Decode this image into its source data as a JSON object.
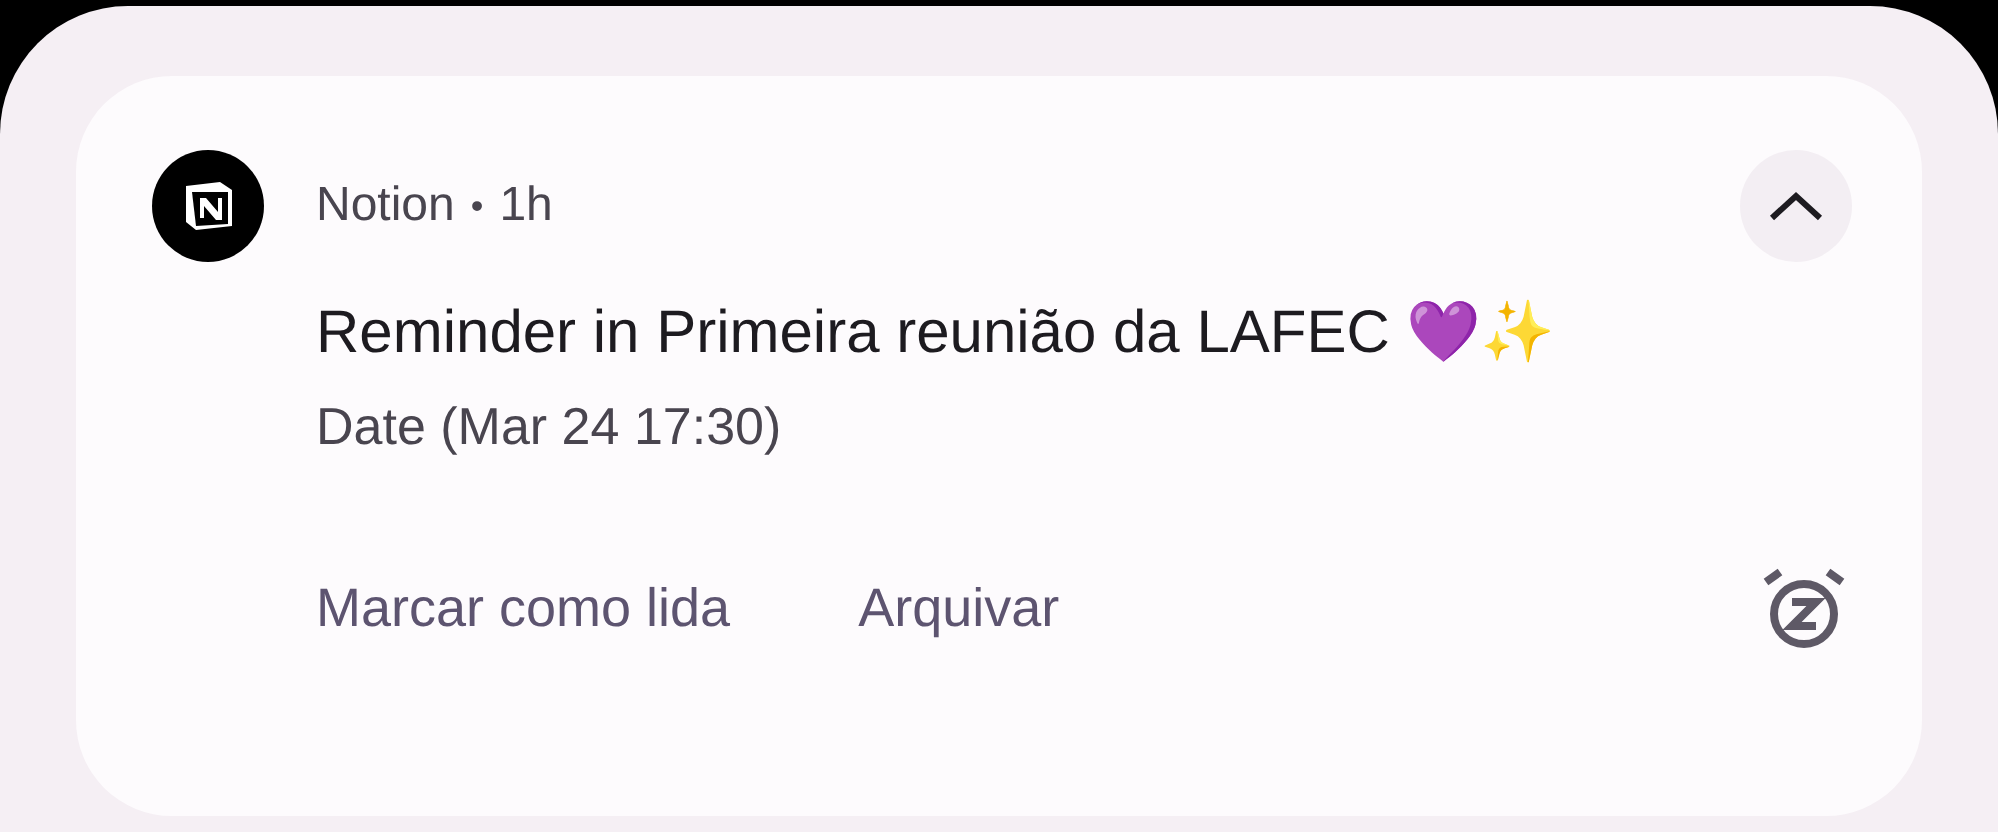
{
  "notification": {
    "app_name": "Notion",
    "separator": "•",
    "time": "1h",
    "expanded": true,
    "title": "Reminder in Primeira reunião da LAFEC 💜✨",
    "body": "Date (Mar 24 17:30)",
    "actions": [
      "Marcar como lida",
      "Arquivar"
    ]
  }
}
